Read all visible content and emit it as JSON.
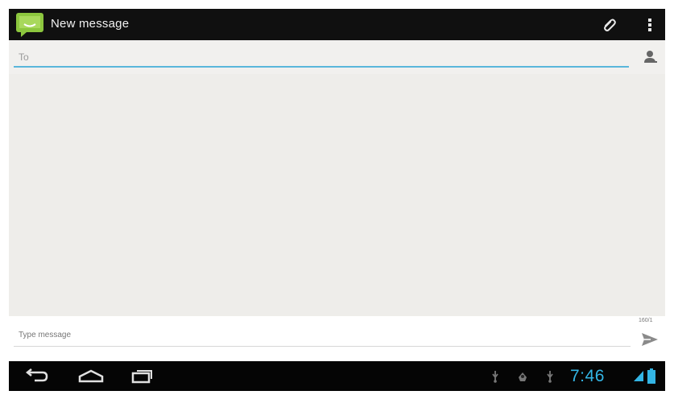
{
  "action_bar": {
    "title": "New message",
    "icons": [
      "messaging-app-icon",
      "paperclip-icon",
      "overflow-menu-icon"
    ]
  },
  "recipient": {
    "placeholder": "To"
  },
  "compose": {
    "placeholder": "Type message",
    "counter": "160/1"
  },
  "system_bar": {
    "time": "7:46",
    "icons": [
      "back-icon",
      "home-icon",
      "recent-apps-icon",
      "usb-icon",
      "debug-icon",
      "signal-icon",
      "battery-icon"
    ]
  },
  "colors": {
    "action_bar_bg": "#101010",
    "accent": "#33b5e5",
    "underline": "#59b6db",
    "app_icon_green": "#8cc63e",
    "content_bg": "#eeedea"
  }
}
